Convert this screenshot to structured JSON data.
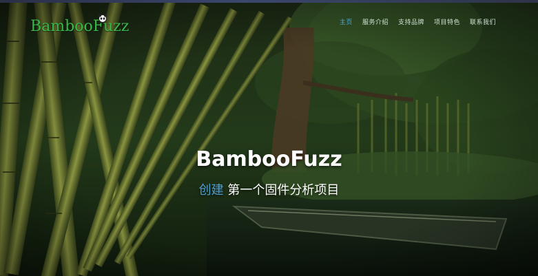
{
  "brand": {
    "name": "BambooFuzz",
    "color": "#39b84a"
  },
  "nav": {
    "items": [
      {
        "label": "主页",
        "active": true
      },
      {
        "label": "服务介绍",
        "active": false
      },
      {
        "label": "支持品牌",
        "active": false
      },
      {
        "label": "项目特色",
        "active": false
      },
      {
        "label": "联系我们",
        "active": false
      }
    ]
  },
  "hero": {
    "title": "BambooFuzz",
    "subtitle_accent": "创建",
    "subtitle_rest": " 第一个固件分析项目"
  },
  "colors": {
    "accent": "#4f9ed0",
    "nav_text": "#cfe0d2"
  },
  "icons": {
    "logo": "panda-icon"
  }
}
